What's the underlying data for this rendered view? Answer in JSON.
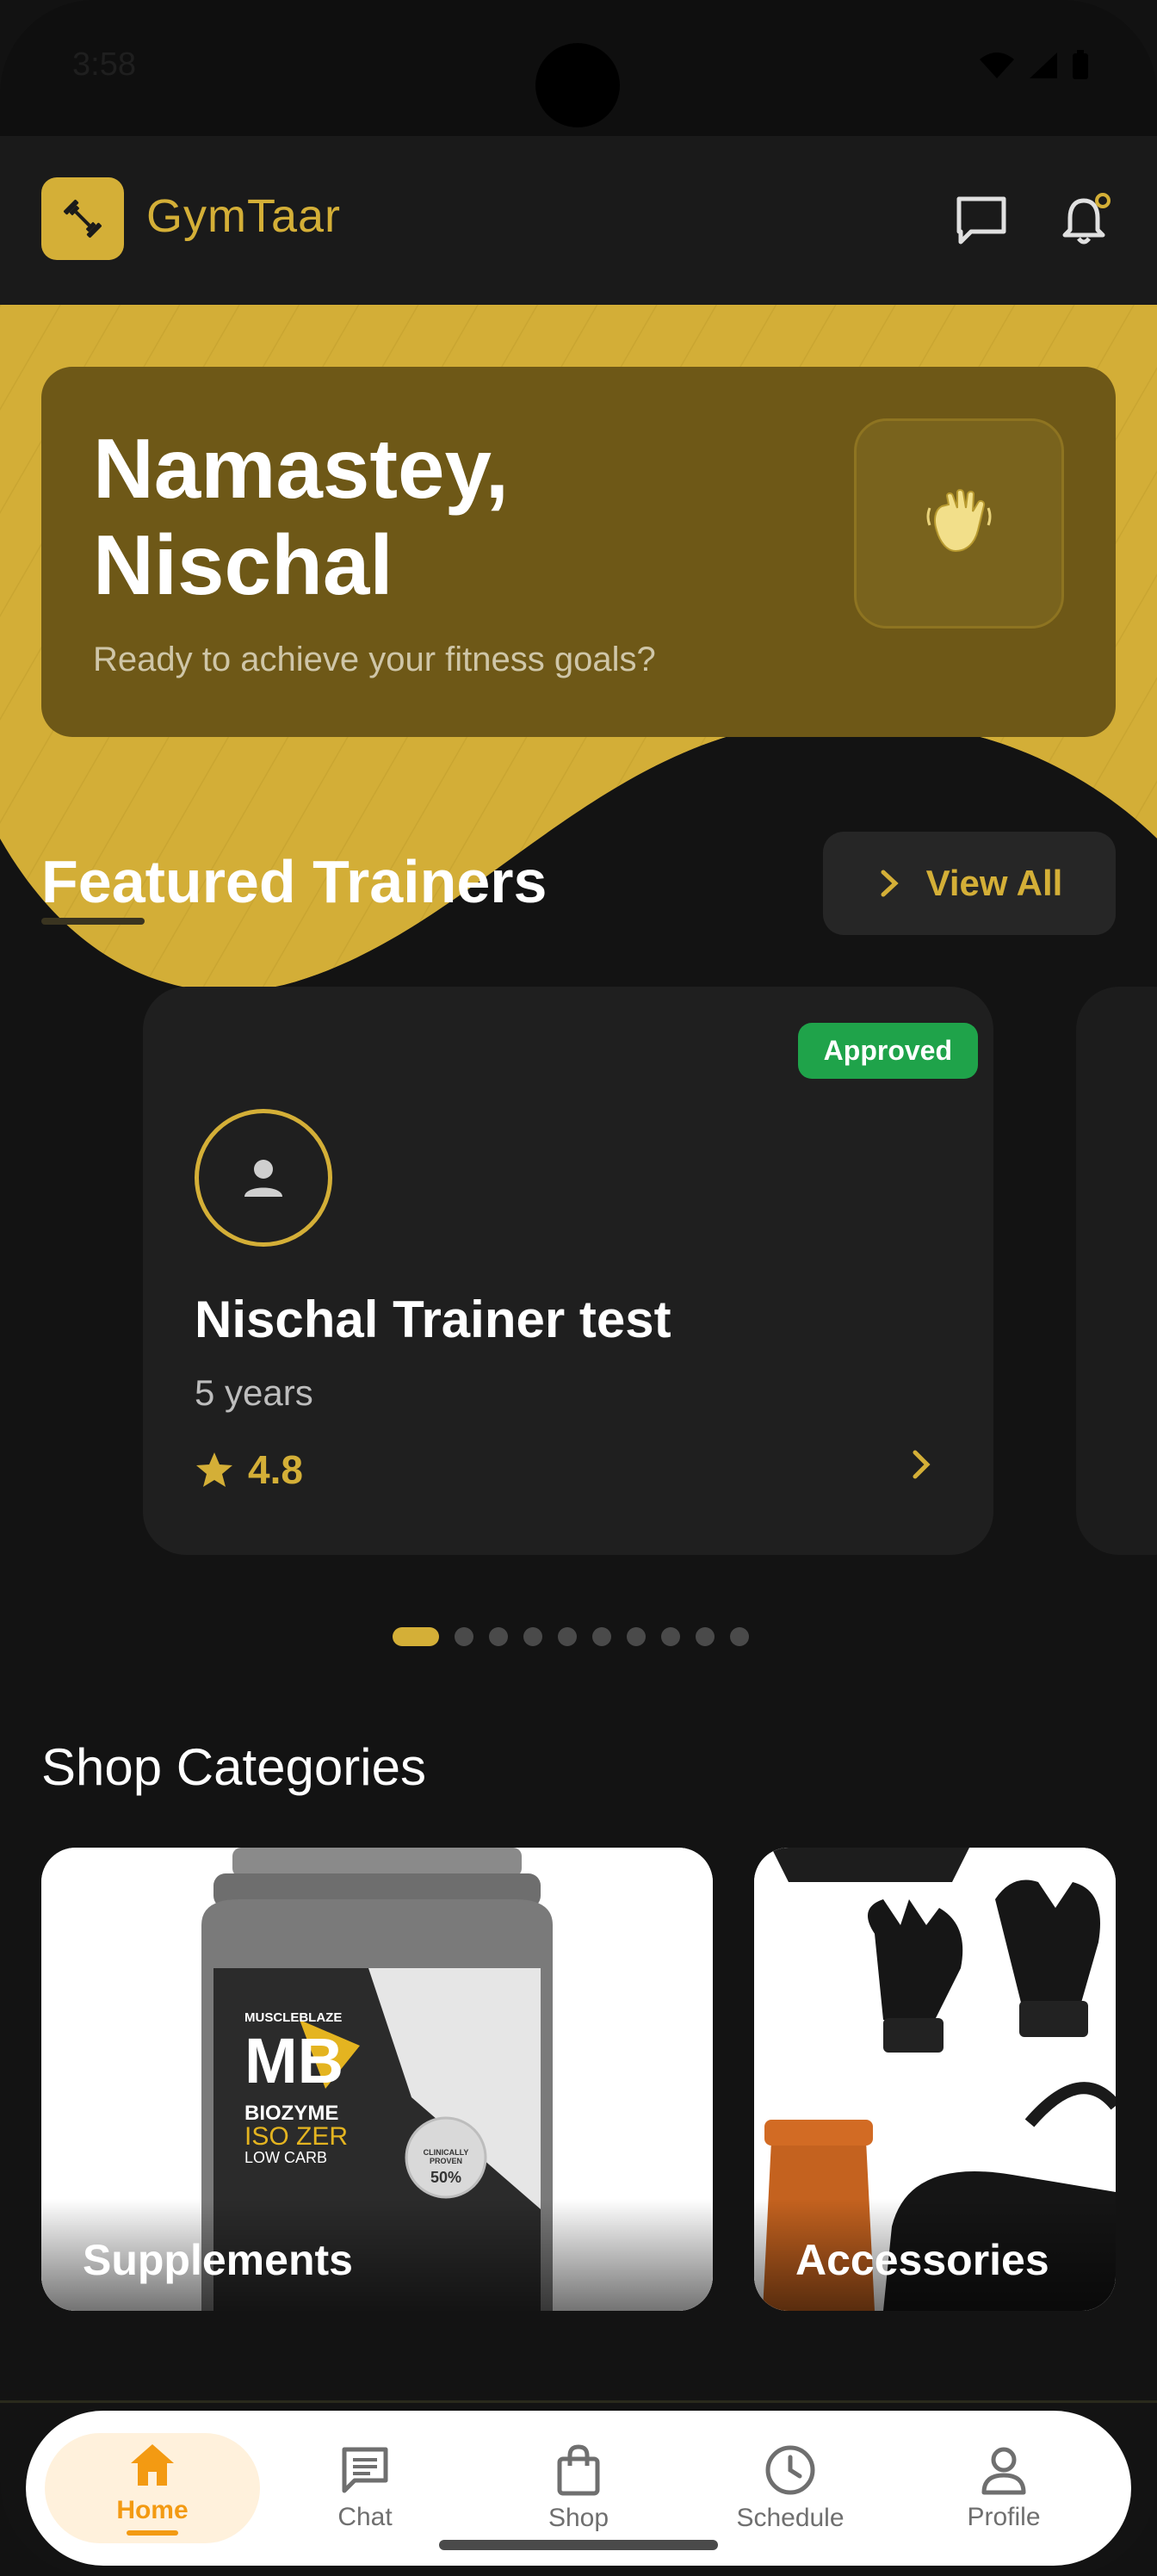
{
  "status_bar": {
    "time": "3:58"
  },
  "app_bar": {
    "title": "GymTaar"
  },
  "greeting": {
    "title": "Namastey, Nischal",
    "subtitle": "Ready to achieve your fitness goals?"
  },
  "featured": {
    "title": "Featured Trainers",
    "view_all_label": "View All",
    "trainer": {
      "status": "Approved",
      "name": "Nischal Trainer test",
      "experience": "5 years",
      "rating": "4.8"
    },
    "carousel_total": 10,
    "carousel_active": 1
  },
  "shop": {
    "title": "Shop Categories",
    "categories": [
      {
        "label": "Supplements",
        "product_text": {
          "brand": "MUSCLEBLAZE",
          "line1": "BIOZYME",
          "line2": "ISO ZER",
          "line3": "LOW CARB",
          "badge": "CLINICALLY PROVEN",
          "percent": "50%"
        }
      },
      {
        "label": "Accessories"
      }
    ]
  },
  "bottom_nav": {
    "items": [
      {
        "label": "Home",
        "icon": "home-icon",
        "active": true
      },
      {
        "label": "Chat",
        "icon": "chat-icon"
      },
      {
        "label": "Shop",
        "icon": "shopping-bag-icon"
      },
      {
        "label": "Schedule",
        "icon": "clock-icon"
      },
      {
        "label": "Profile",
        "icon": "person-icon"
      }
    ]
  },
  "colors": {
    "accent": "#d4af37",
    "approved": "#1fa34a",
    "nav_active": "#f39a12"
  }
}
